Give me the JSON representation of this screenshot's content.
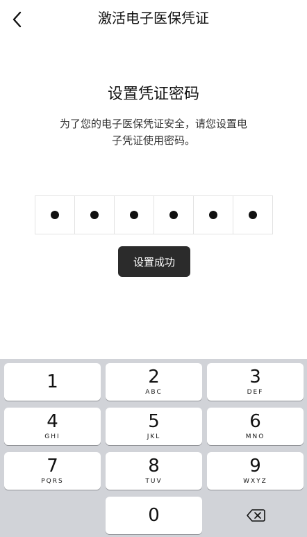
{
  "nav": {
    "title": "激活电子医保凭证"
  },
  "content": {
    "heading": "设置凭证密码",
    "subtitle": "为了您的电子医保凭证安全，请您设置电子凭证使用密码。",
    "pin_filled": 6,
    "pin_length": 6
  },
  "toast": {
    "text": "设置成功"
  },
  "keypad": {
    "k1": {
      "num": "1",
      "letters": ""
    },
    "k2": {
      "num": "2",
      "letters": "ABC"
    },
    "k3": {
      "num": "3",
      "letters": "DEF"
    },
    "k4": {
      "num": "4",
      "letters": "GHI"
    },
    "k5": {
      "num": "5",
      "letters": "JKL"
    },
    "k6": {
      "num": "6",
      "letters": "MNO"
    },
    "k7": {
      "num": "7",
      "letters": "PQRS"
    },
    "k8": {
      "num": "8",
      "letters": "TUV"
    },
    "k9": {
      "num": "9",
      "letters": "WXYZ"
    },
    "k0": {
      "num": "0",
      "letters": ""
    }
  }
}
